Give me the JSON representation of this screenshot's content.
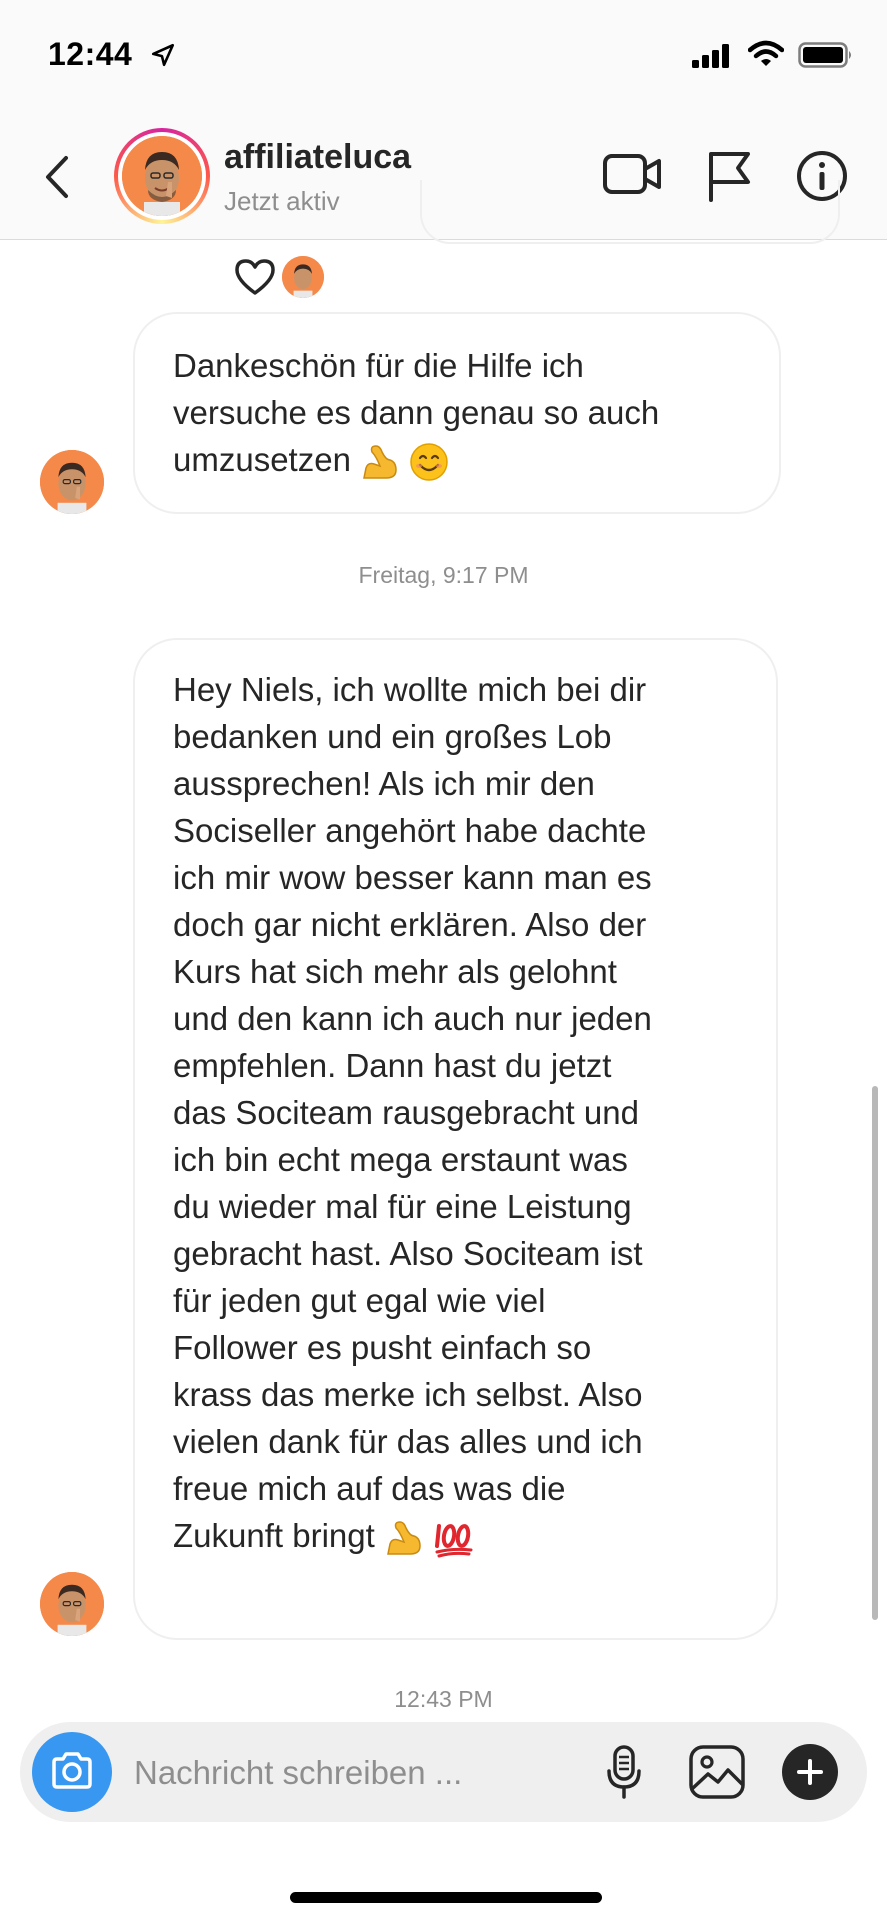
{
  "status_bar": {
    "time": "12:44"
  },
  "header": {
    "username": "affiliateluca",
    "activity": "Jetzt aktiv"
  },
  "conversation": {
    "message_1": {
      "lines": [
        "Dankeschön für die Hilfe ich",
        "versuche es dann genau so auch",
        "umzusetzen"
      ],
      "emoji": [
        "flexed-biceps",
        "smiling-face"
      ]
    },
    "timestamp_1": "Freitag, 9:17 PM",
    "message_2": {
      "lines": [
        "Hey Niels, ich wollte mich bei dir",
        "bedanken und ein großes Lob",
        "aussprechen! Als ich mir den",
        "Sociseller angehört habe dachte",
        "ich mir wow besser kann man es",
        "doch gar nicht erklären. Also der",
        "Kurs hat sich mehr als gelohnt",
        "und den kann ich auch nur jeden",
        "empfehlen. Dann hast du jetzt",
        "das Sociteam rausgebracht und",
        "ich bin echt mega erstaunt was",
        "du wieder mal für eine Leistung",
        "gebracht hast. Also Sociteam ist",
        "für jeden gut egal wie viel",
        "Follower es pusht einfach so",
        "krass das merke ich selbst. Also",
        "vielen dank für das alles und ich",
        "freue mich auf das was die",
        "Zukunft bringt"
      ],
      "emoji": [
        "flexed-biceps",
        "hundred-points"
      ]
    },
    "timestamp_2": "12:43 PM"
  },
  "composer": {
    "placeholder": "Nachricht schreiben ..."
  },
  "colors": {
    "accent": "#3897f0",
    "avatar_bg": "#f4894a",
    "text_primary": "#262626",
    "text_secondary": "#8e8e8e",
    "bubble_border": "#efefef"
  },
  "icons": [
    "location-arrow-icon",
    "signal-icon",
    "wifi-icon",
    "battery-icon",
    "back-icon",
    "video-call-icon",
    "flag-icon",
    "info-icon",
    "heart-icon",
    "camera-icon",
    "microphone-icon",
    "gallery-icon",
    "plus-icon"
  ]
}
